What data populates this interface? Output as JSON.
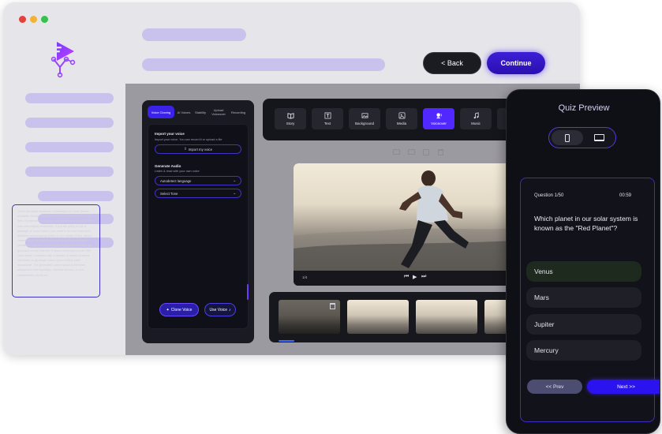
{
  "window": {
    "controls": [
      {
        "name": "close",
        "color": "#e5403a"
      },
      {
        "name": "minimize",
        "color": "#f2b233"
      },
      {
        "name": "maximize",
        "color": "#35c24a"
      }
    ]
  },
  "nav": {
    "back_label": "< Back",
    "continue_label": "Continue"
  },
  "voice_panel": {
    "tabs": [
      "Voice Cloning",
      "AI Voices",
      "Stability",
      "Upload Voiceover",
      "Recording"
    ],
    "import_title": "Import your voice",
    "import_hint": "Import your voice. You can record it or upload a file",
    "import_button": "Import my voice",
    "generate_title": "Generate Audio",
    "generate_hint": "Listen & read with your own voice",
    "language_select": "Autodetect language",
    "tone_select": "Select Tone",
    "script_text": "There are many variations of passages of Lorem Ipsum available, but the majority have suffered alteration in some form, by injected humour, or randomised words which don't look even slightly believable. If you are going to use a passage of Lorem Ipsum, you need to be sure there isn't anything embarrassing hidden in the middle of text. All the Lorem Ipsum generators on the Internet tend to repeat predefined chunks as necessary, making this the first true generator on the Internet. It uses a dictionary of over 200 Latin words, combined with a handful of model sentence structures, to generate Lorem Ipsum which looks reasonable. The generated Lorem Ipsum is therefore always free from repetition, injected humour, or non-characteristic words etc.",
    "clone_button": "Clone Voice",
    "use_button": "Use Voice"
  },
  "toolbar": {
    "tools": [
      {
        "label": "Story",
        "icon": "book-icon"
      },
      {
        "label": "Text",
        "icon": "text-icon"
      },
      {
        "label": "Background",
        "icon": "image-icon"
      },
      {
        "label": "Media",
        "icon": "media-icon"
      },
      {
        "label": "Voiceover",
        "icon": "voiceover-icon"
      },
      {
        "label": "Music",
        "icon": "music-icon"
      }
    ],
    "active": "Voiceover"
  },
  "video": {
    "counter": "1/4"
  },
  "quiz": {
    "title": "Quiz Preview",
    "question_label": "Question 1/50",
    "timer": "00:59",
    "question": "Which planet in our solar system is known as the \"Red Planet\"?",
    "options": [
      "Venus",
      "Mars",
      "Jupiter",
      "Mercury"
    ],
    "selected": "Venus",
    "prev_label": "<< Prev",
    "next_label": "Next >>"
  },
  "colors": {
    "accent": "#2b13f0",
    "active_tab": "#5128ff",
    "selected_option": "#1d2a1d"
  }
}
